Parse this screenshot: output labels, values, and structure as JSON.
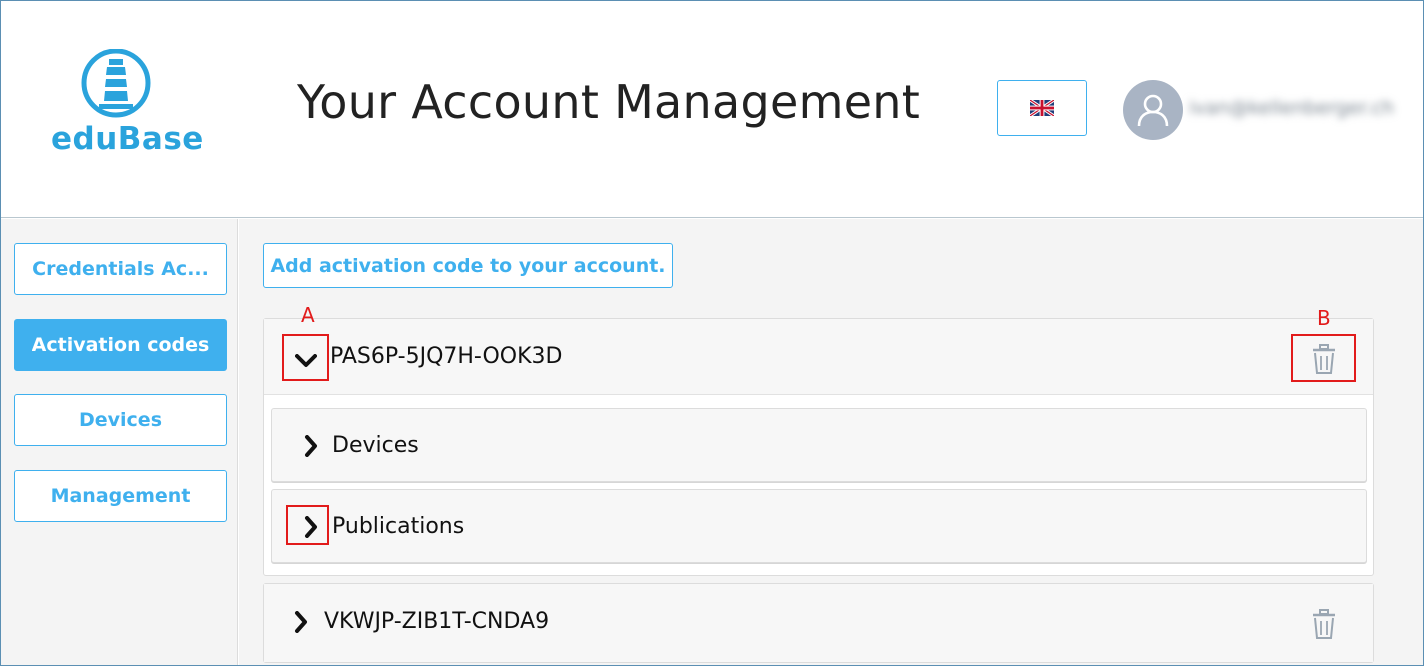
{
  "header": {
    "logo_text": "eduBase",
    "page_title": "Your Account Management",
    "language_flag": "uk-flag-icon",
    "user_email": "ivan@kellenberger.ch"
  },
  "sidebar": {
    "items": [
      {
        "label": "Credentials Ac...",
        "active": false
      },
      {
        "label": "Activation codes",
        "active": true
      },
      {
        "label": "Devices",
        "active": false
      },
      {
        "label": "Management",
        "active": false
      }
    ]
  },
  "main": {
    "add_button_label": "Add activation code to your account.",
    "codes": [
      {
        "code": "PAS6P-5JQ7H-OOK3D",
        "expanded": true,
        "sections": [
          {
            "label": "Devices",
            "expanded": false
          },
          {
            "label": "Publications",
            "expanded": false
          }
        ]
      },
      {
        "code": "VKWJP-ZIB1T-CNDA9",
        "expanded": false,
        "sections": []
      }
    ]
  },
  "annotations": {
    "a_label": "A",
    "b_label": "B"
  },
  "colors": {
    "accent": "#3fb0ee",
    "annotation": "#e21b1b"
  }
}
